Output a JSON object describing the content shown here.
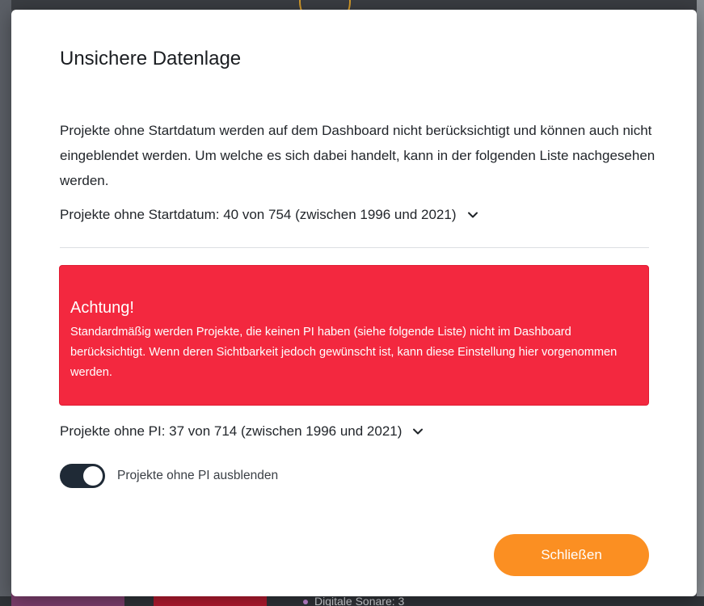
{
  "background": {
    "partial_text": "Digitale Sonare: 3"
  },
  "modal": {
    "title": "Unsichere Datenlage",
    "intro": "Projekte ohne Startdatum werden auf dem Dashboard nicht berücksichtigt und können auch nicht eingeblendet werden. Um welche es sich dabei handelt, kann in der folgenden Liste nachgesehen werden.",
    "no_start_date_summary": "Projekte ohne Startdatum: 40 von 754 (zwischen 1996 und 2021)",
    "alert": {
      "heading": "Achtung!",
      "text": "Standardmäßig werden Projekte, die keinen PI haben (siehe folgende Liste) nicht im Dashboard berücksichtigt. Wenn deren Sichtbarkeit jedoch gewünscht ist, kann diese Einstellung hier vorgenommen werden."
    },
    "no_pi_summary": "Projekte ohne PI: 37 von 714 (zwischen 1996 und 2021)",
    "toggle": {
      "label": "Projekte ohne PI ausblenden",
      "checked": true
    },
    "close_label": "Schließen"
  },
  "colors": {
    "alert_bg": "#f3283f",
    "toggle_on": "#1f2a36",
    "primary_button": "#fb8f22"
  },
  "icons": {
    "expand": "chevron-down-icon"
  }
}
